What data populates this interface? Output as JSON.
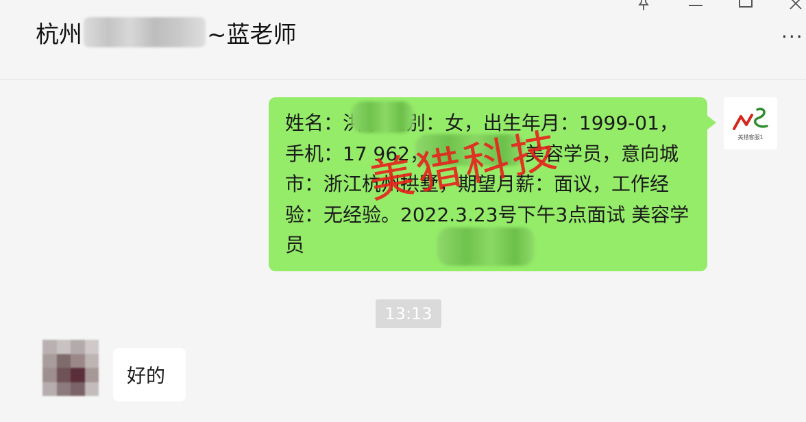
{
  "header": {
    "title_prefix": "杭州",
    "title_suffix": "~蓝老师",
    "more_label": "···"
  },
  "messages": {
    "outgoing_text": "姓名：",
    "outgoing_full": "姓名：洪 ，性别：女，出生年月：1999-01，手机：17 962，求职岗位：美容学员，意向城市：浙江杭州拱墅，期望月薪：面议，工作经验：无经验。2022.3.23号下午3点面试 美容学员",
    "timestamp": "13:13",
    "incoming_text": "好的"
  },
  "watermark": {
    "text": "美猎科技",
    "color": "#e8201c"
  },
  "logo": {
    "tag": "美猎客服1"
  },
  "colors": {
    "outgoing_bubble": "#95ec69",
    "incoming_bubble": "#ffffff",
    "background": "#f5f5f5"
  }
}
